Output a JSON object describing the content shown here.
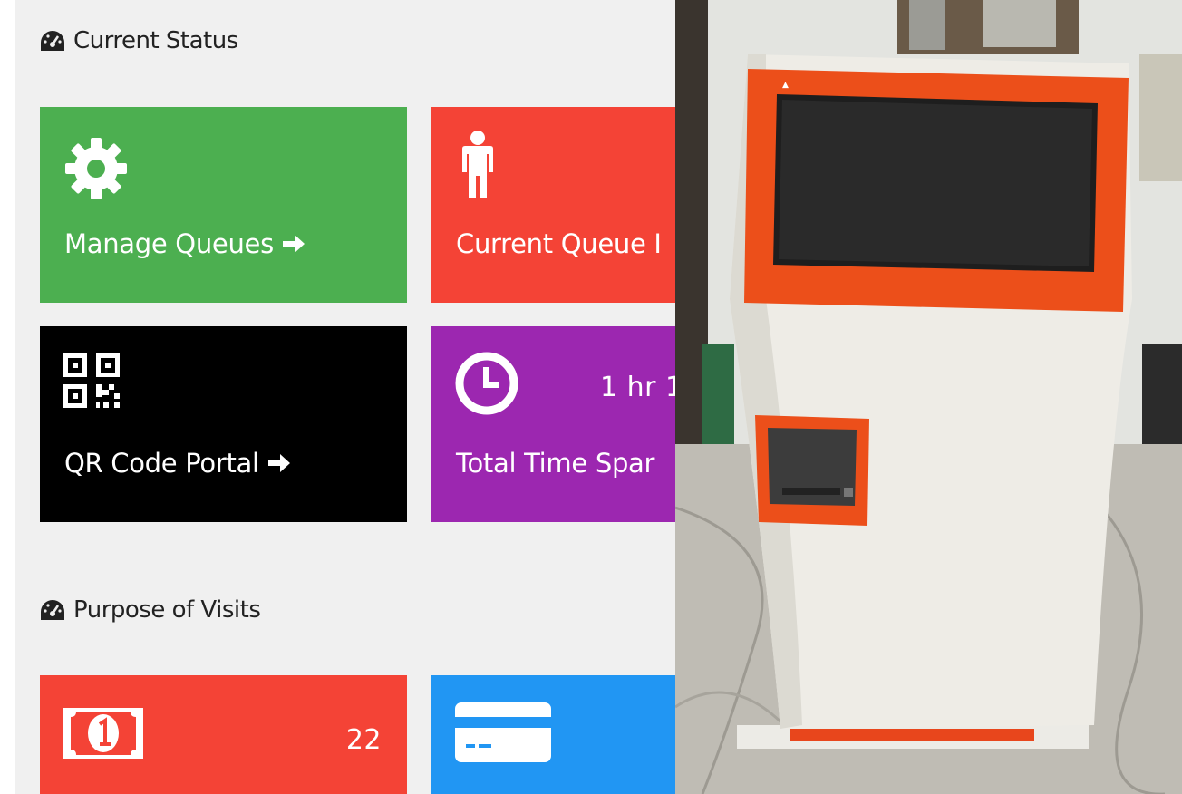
{
  "sections": {
    "current_status": "Current Status",
    "purpose_of_visits": "Purpose of Visits"
  },
  "tiles": {
    "manage_queues": {
      "label": "Manage Queues",
      "icon": "gear-icon",
      "color": "#4caf50"
    },
    "current_queue": {
      "label": "Current Queue I",
      "icon": "person-icon",
      "color": "#f44336"
    },
    "qr_code_portal": {
      "label": "QR Code Portal",
      "icon": "qr-code-icon",
      "color": "#000000"
    },
    "total_time": {
      "label": "Total Time Spar",
      "value": "1 hr 1",
      "icon": "clock-icon",
      "color": "#9c27b0"
    },
    "purpose_money": {
      "value": "22",
      "icon": "money-icon",
      "color": "#f44336"
    },
    "purpose_card": {
      "icon": "credit-card-icon",
      "color": "#2196f3"
    }
  },
  "photo": {
    "subject": "kiosk-photo",
    "accent": "#ff5a1f"
  }
}
